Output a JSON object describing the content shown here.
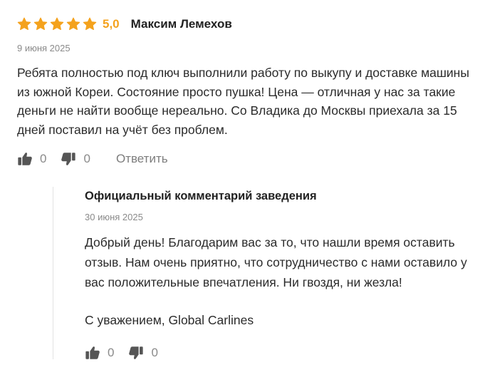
{
  "review": {
    "stars": 5,
    "rating": "5,0",
    "author": "Максим Лемехов",
    "date": "9 июня 2025",
    "text": "Ребята полностью под ключ выполнили работу по выкупу и доставке машины из южной Кореи. Состояние просто пушка! Цена — отличная у нас за такие деньги не найти вообще нереально. Со Владика до Москвы приехала за 15 дней поставил на учёт без проблем.",
    "likes": "0",
    "dislikes": "0",
    "reply_label": "Ответить"
  },
  "official": {
    "title": "Официальный комментарий заведения",
    "date": "30 июня 2025",
    "text": "Добрый день! Благодарим вас за то, что нашли время оставить отзыв. Нам очень приятно, что сотрудничество с нами оставило у вас положительные впечатления. Ни гвоздя, ни жезла!",
    "signature": "С уважением, Global Carlines",
    "likes": "0",
    "dislikes": "0"
  },
  "colors": {
    "star": "#f4a21d",
    "muted": "#8a8a8a",
    "icon": "#555555",
    "divider": "#e3e3e3"
  },
  "icons": [
    "star-icon",
    "thumbs-up-icon",
    "thumbs-down-icon"
  ]
}
